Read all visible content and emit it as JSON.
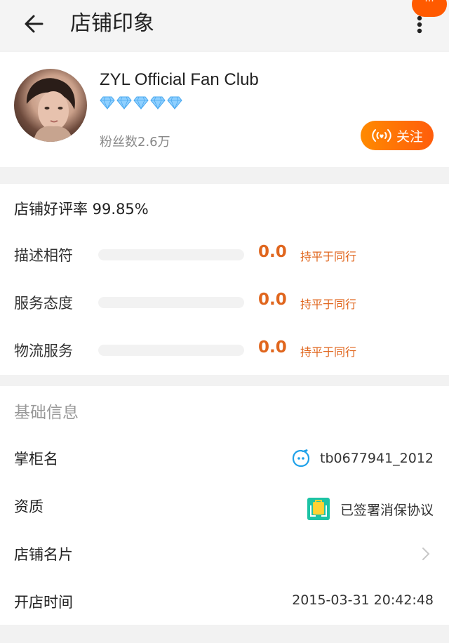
{
  "header": {
    "title": "店铺印象",
    "badge": "···",
    "icons": {
      "back": "back-arrow-icon",
      "more": "more-vertical-icon"
    }
  },
  "shop": {
    "name": "ZYL Official Fan Club",
    "level_icon": "diamond-icon",
    "level_count": 5,
    "fans_label": "粉丝数2.6万",
    "follow_label": "关注",
    "accent": "#ff5d0c"
  },
  "ratings": {
    "good_rate_label": "店铺好评率 99.85%",
    "items": [
      {
        "label": "描述相符",
        "score": "0.0",
        "compare": "持平于同行",
        "fill": 0
      },
      {
        "label": "服务态度",
        "score": "0.0",
        "compare": "持平于同行",
        "fill": 0
      },
      {
        "label": "物流服务",
        "score": "0.0",
        "compare": "持平于同行",
        "fill": 0
      }
    ]
  },
  "info": {
    "section_title": "基础信息",
    "rows": [
      {
        "label": "掌柜名",
        "value": "tb0677941_2012",
        "icon": "wangwang-chat-icon"
      },
      {
        "label": "资质",
        "value": "已签署消保协议",
        "icon": "consumer-protection-icon"
      },
      {
        "label": "店铺名片",
        "value": "",
        "icon": "chevron-right-icon"
      },
      {
        "label": "开店时间",
        "value": "2015-03-31 20:42:48"
      }
    ]
  }
}
